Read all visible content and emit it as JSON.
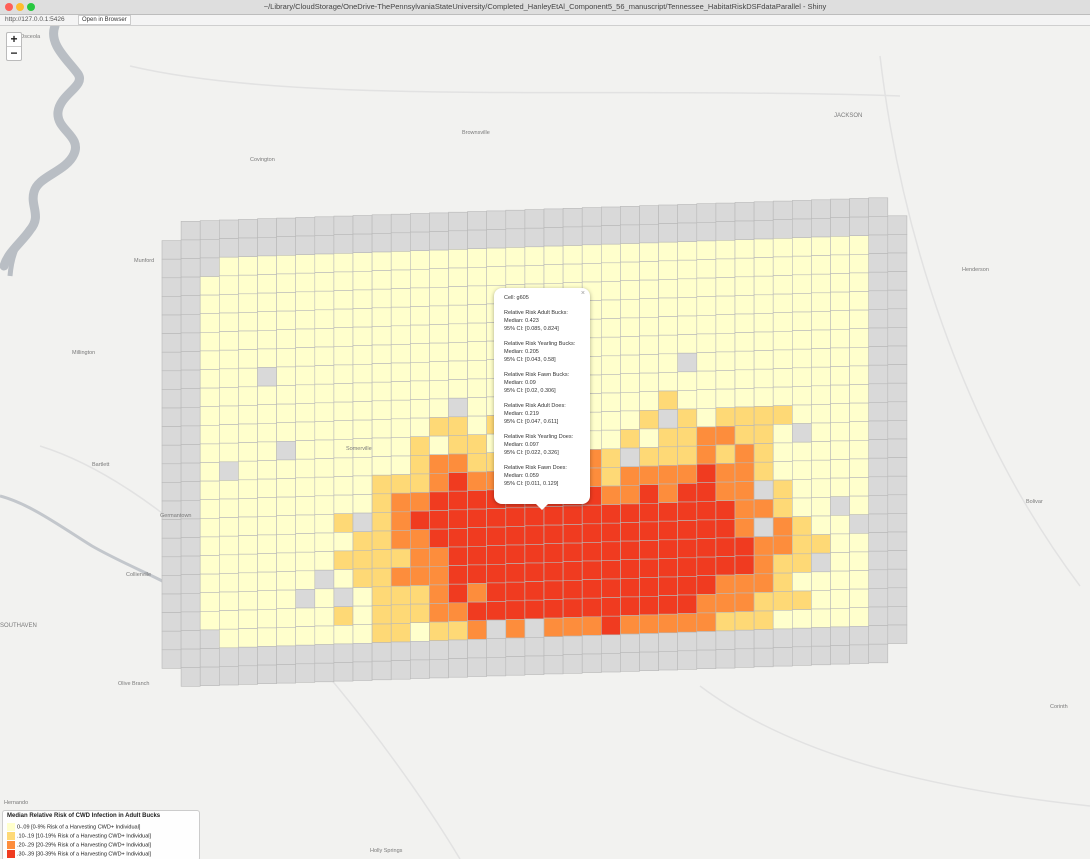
{
  "window": {
    "title": "~/Library/CloudStorage/OneDrive-ThePennsylvaniaStateUniversity/Completed_HanleyEtAl_Component5_56_manuscript/Tennessee_HabitatRiskDSFdataParallel - Shiny",
    "url": "http://127.0.0.1:5426",
    "open_browser": "Open in Browser"
  },
  "zoom": {
    "plus": "+",
    "minus": "−"
  },
  "places": [
    {
      "name": "Osceola"
    },
    {
      "name": "JACKSON"
    },
    {
      "name": "Brownsville"
    },
    {
      "name": "Covington"
    },
    {
      "name": "Munford"
    },
    {
      "name": "Henderson"
    },
    {
      "name": "Millington"
    },
    {
      "name": "Bartlett"
    },
    {
      "name": "Germantown"
    },
    {
      "name": "Collierville"
    },
    {
      "name": "Bolivar"
    },
    {
      "name": "Somerville"
    },
    {
      "name": "SOUTHAVEN"
    },
    {
      "name": "Olive Branch"
    },
    {
      "name": "Corinth"
    },
    {
      "name": "Hernando"
    },
    {
      "name": "Holly Springs"
    }
  ],
  "colors": {
    "bin0": "#ffffcc",
    "bin1": "#fed976",
    "bin2": "#fd8d3c",
    "bin3": "#f03b20",
    "na": "#d9d9d9",
    "gridline": "#b8b8b8"
  },
  "popup": {
    "close": "×",
    "cell": "Cell: g605",
    "blocks": [
      {
        "title": "Relative Risk Adult Bucks:",
        "median": "Median: 0.423",
        "ci": "95% CI: [0.085, 0.824]"
      },
      {
        "title": "Relative Risk Yearling Bucks:",
        "median": "Median: 0.205",
        "ci": "95% CI: [0.043, 0.58]"
      },
      {
        "title": "Relative Risk Fawn Bucks:",
        "median": "Median: 0.09",
        "ci": "95% CI: [0.02, 0.306]"
      },
      {
        "title": "Relative Risk Adult Does:",
        "median": "Median: 0.219",
        "ci": "95% CI: [0.047, 0.611]"
      },
      {
        "title": "Relative Risk Yearling Does:",
        "median": "Median: 0.097",
        "ci": "95% CI: [0.022, 0.326]"
      },
      {
        "title": "Relative Risk Fawn Does:",
        "median": "Median: 0.059",
        "ci": "95% CI: [0.011, 0.129]"
      }
    ]
  },
  "legend": {
    "title": "Median Relative Risk of CWD Infection in Adult Bucks",
    "items": [
      {
        "label": "0-.09 [0-9% Risk of a Harvesting CWD+ Individual]"
      },
      {
        "label": ".10-.19 [10-19% Risk of a Harvesting CWD+ Individual]"
      },
      {
        "label": ".20-.29 [20-29% Risk of a Harvesting CWD+ Individual]"
      },
      {
        "label": ".30-.39 [30-39% Risk of a Harvesting CWD+ Individual]"
      }
    ]
  }
}
